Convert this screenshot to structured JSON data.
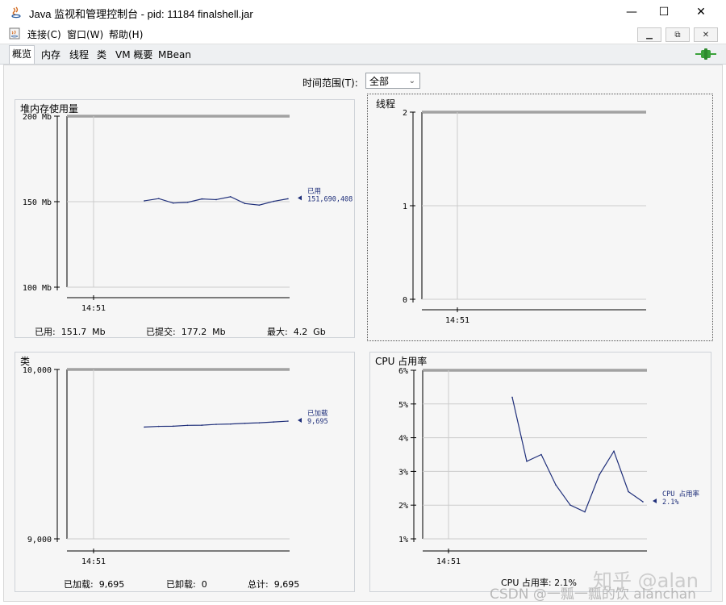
{
  "window": {
    "title": "Java 监视和管理控制台 - pid: 11184 finalshell.jar",
    "controls": [
      "—",
      "☐",
      "✕"
    ]
  },
  "menu": {
    "items": [
      "连接(C)",
      "窗口(W)",
      "帮助(H)"
    ],
    "mdi_controls": [
      "▁",
      "⧉",
      "✕"
    ]
  },
  "tabs": [
    "概览",
    "内存",
    "线程",
    "类",
    "VM 概要",
    "MBean"
  ],
  "active_tab": "概览",
  "time_range": {
    "label": "时间范围(T):",
    "value": "全部"
  },
  "colors": {
    "series": "#1f2f7a",
    "grid": "#cccccc",
    "connected": "#3aa13a"
  },
  "panels": {
    "heap": {
      "title": "堆内存使用量",
      "stats": [
        "已用:  151.7  Mb",
        "已提交:  177.2  Mb",
        "最大:  4.2  Gb"
      ]
    },
    "threads": {
      "title": "线程"
    },
    "classes": {
      "title": "类",
      "stats": [
        "已加载:  9,695",
        "已卸载:  0",
        "总计:  9,695"
      ]
    },
    "cpu": {
      "title": "CPU 占用率",
      "stats": [
        "CPU 占用率: 2.1%"
      ]
    }
  },
  "chart_data": [
    {
      "type": "line",
      "title": "堆内存使用量",
      "yticks": [
        "200 Mb",
        "150 Mb",
        "100 Mb"
      ],
      "ylim": [
        100,
        200
      ],
      "xticks": [
        "14:51"
      ],
      "series": [
        {
          "name": "已用",
          "values": [
            150.5,
            151.8,
            149.2,
            149.6,
            151.6,
            151.2,
            152.9,
            148.9,
            148.0,
            150.2,
            151.7
          ]
        }
      ],
      "current_label": "已用",
      "current_value": "151,690,408"
    },
    {
      "type": "line",
      "title": "线程",
      "yticks": [
        "2",
        "1",
        "0"
      ],
      "ylim": [
        0,
        2
      ],
      "xticks": [
        "14:51"
      ],
      "series": []
    },
    {
      "type": "line",
      "title": "类",
      "yticks": [
        "10,000",
        "9,000"
      ],
      "ylim": [
        9000,
        10000
      ],
      "xticks": [
        "14:51"
      ],
      "series": [
        {
          "name": "已加载",
          "values": [
            9660,
            9664,
            9665,
            9670,
            9671,
            9676,
            9678,
            9682,
            9685,
            9690,
            9695
          ]
        }
      ],
      "current_label": "已加载",
      "current_value": "9,695"
    },
    {
      "type": "line",
      "title": "CPU 占用率",
      "yticks": [
        "6%",
        "5%",
        "4%",
        "3%",
        "2%",
        "1%"
      ],
      "ylim": [
        1,
        6
      ],
      "xticks": [
        "14:51"
      ],
      "series": [
        {
          "name": "CPU 占用率",
          "values": [
            5.2,
            3.3,
            3.5,
            2.6,
            2.0,
            1.8,
            2.9,
            3.6,
            2.4,
            2.1
          ]
        }
      ],
      "current_label": "CPU 占用率",
      "current_value": "2.1%"
    }
  ],
  "watermarks": [
    "知乎 @alan",
    "CSDN @一瓢一瓢的饮 alanchan"
  ]
}
